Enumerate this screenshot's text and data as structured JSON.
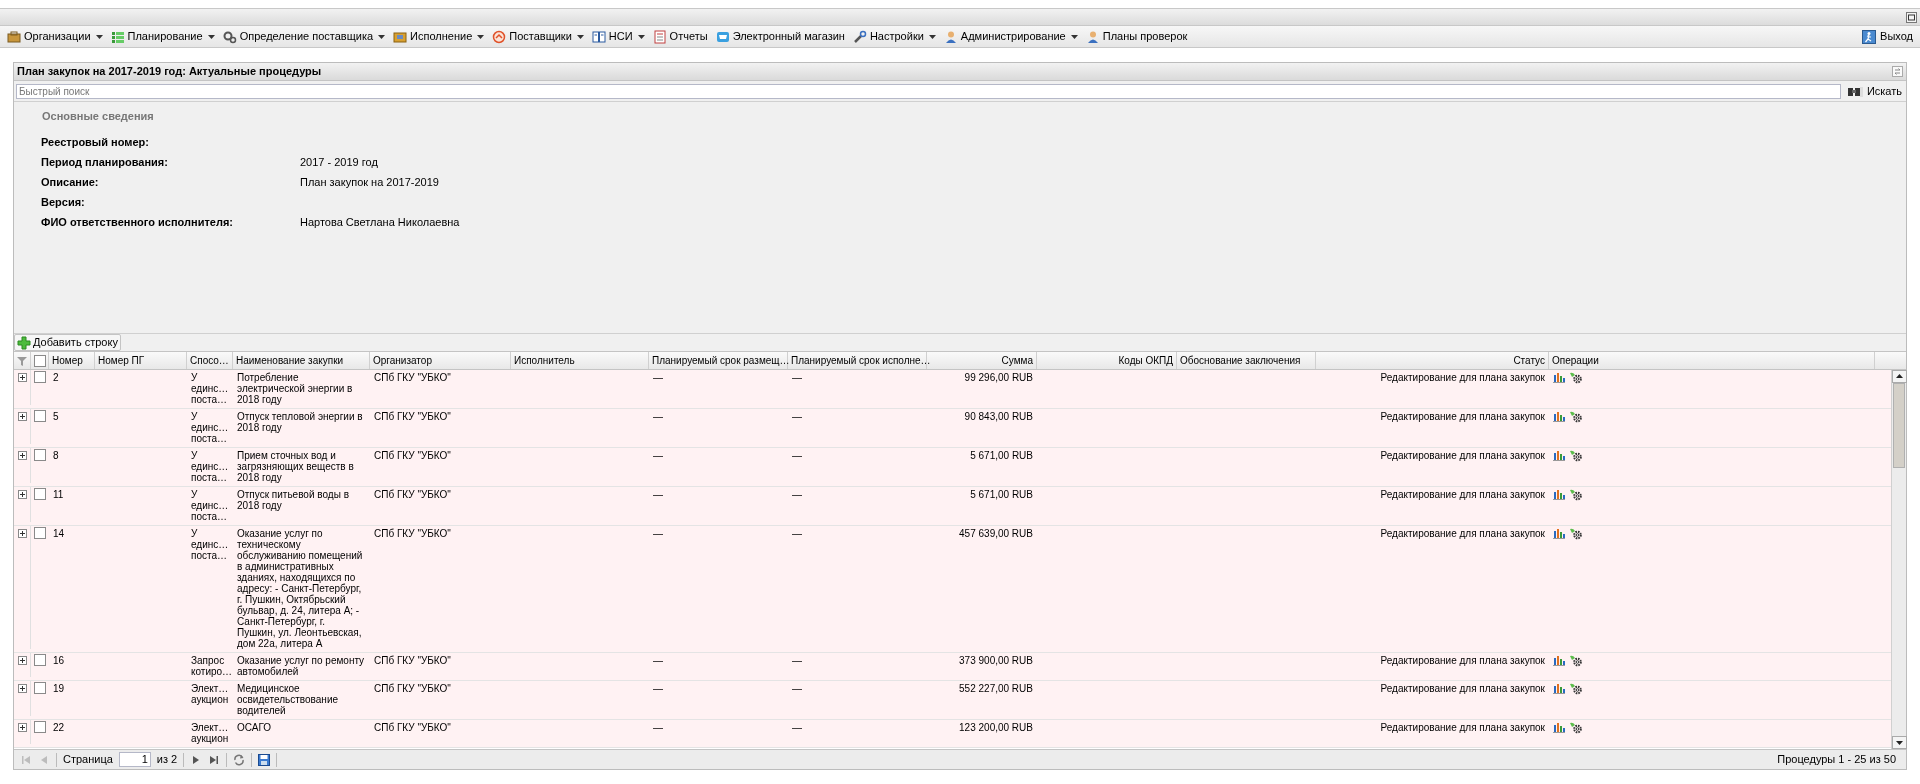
{
  "menu": [
    {
      "label": "Организации",
      "dropdown": true
    },
    {
      "label": "Планирование",
      "dropdown": true
    },
    {
      "label": "Определение поставщика",
      "dropdown": true
    },
    {
      "label": "Исполнение",
      "dropdown": true
    },
    {
      "label": "Поставщики",
      "dropdown": true
    },
    {
      "label": "НСИ",
      "dropdown": true
    },
    {
      "label": "Отчеты",
      "dropdown": false
    },
    {
      "label": "Электронный магазин",
      "dropdown": false
    },
    {
      "label": "Настройки",
      "dropdown": true
    },
    {
      "label": "Администрирование",
      "dropdown": true
    },
    {
      "label": "Планы проверок",
      "dropdown": false
    }
  ],
  "logout": "Выход",
  "panel": {
    "title": "План закупок на 2017-2019 год: Актуальные процедуры",
    "search": {
      "placeholder": "Быстрый поиск",
      "button": "Искать"
    },
    "section_title": "Основные сведения",
    "fields": [
      {
        "label": "Реестровый номер:"
      },
      {
        "label": "Период планирования:",
        "value": "2017 - 2019 год"
      },
      {
        "label": "Описание:",
        "value": "План закупок на 2017-2019"
      },
      {
        "label": "Версия:"
      },
      {
        "label": "ФИО ответственного исполнителя:",
        "value": "Нартова Светлана Николаевна"
      }
    ],
    "add_button": "Добавить строку"
  },
  "table": {
    "header_checked": false,
    "columns": [
      "Номер",
      "Номер ПГ",
      "Спосо…",
      "Наименование закупки",
      "Организатор",
      "Исполнитель",
      "Планируемый срок размещ…",
      "Планируемый срок исполне…",
      "Сумма",
      "Коды ОКПД",
      "Обоснование заключения",
      "Статус",
      "Операции"
    ],
    "rows": [
      {
        "checked": false,
        "expanded": false,
        "number": "2",
        "method": "У\nединс…\nпоста…",
        "name": "Потребление электрической энергии в 2018 году",
        "organizer": "СПб ГКУ \"УБКО\"",
        "placement": "—",
        "execution": "—",
        "sum": "99 296,00 RUB",
        "status": "Редактирование для плана закупок"
      },
      {
        "checked": false,
        "expanded": false,
        "number": "5",
        "method": "У\nединс…\nпоста…",
        "name": "Отпуск тепловой энергии в 2018 году",
        "organizer": "СПб ГКУ \"УБКО\"",
        "placement": "—",
        "execution": "—",
        "sum": "90 843,00 RUB",
        "status": "Редактирование для плана закупок"
      },
      {
        "checked": false,
        "expanded": false,
        "number": "8",
        "method": "У\nединс…\nпоста…",
        "name": "Прием сточных вод и загрязняющих веществ в 2018 году",
        "organizer": "СПб ГКУ \"УБКО\"",
        "placement": "—",
        "execution": "—",
        "sum": "5 671,00 RUB",
        "status": "Редактирование для плана закупок"
      },
      {
        "checked": false,
        "expanded": false,
        "number": "11",
        "method": "У\nединс…\nпоста…",
        "name": "Отпуск питьевой воды в 2018 году",
        "organizer": "СПб ГКУ \"УБКО\"",
        "placement": "—",
        "execution": "—",
        "sum": "5 671,00 RUB",
        "status": "Редактирование для плана закупок"
      },
      {
        "checked": false,
        "expanded": false,
        "number": "14",
        "method": "У\nединс…\nпоста…",
        "name": "Оказание услуг по техническому обслуживанию помещений в административных зданиях, находящихся по адресу: - Санкт-Петербург, г. Пушкин, Октябрьский бульвар, д. 24, литера А; - Санкт-Петербург, г. Пушкин, ул. Леонтьевская, дом 22а, литера А",
        "organizer": "СПб ГКУ \"УБКО\"",
        "placement": "—",
        "execution": "—",
        "sum": "457 639,00 RUB",
        "status": "Редактирование для плана закупок"
      },
      {
        "checked": false,
        "expanded": false,
        "number": "16",
        "method": "Запрос\nкотиро…",
        "name": "Оказание услуг по ремонту автомобилей",
        "organizer": "СПб ГКУ \"УБКО\"",
        "placement": "—",
        "execution": "—",
        "sum": "373 900,00 RUB",
        "status": "Редактирование для плана закупок"
      },
      {
        "checked": false,
        "expanded": false,
        "number": "19",
        "method": "Элект…\nаукцион",
        "name": "Медицинское освидетельствование водителей",
        "organizer": "СПб ГКУ \"УБКО\"",
        "placement": "—",
        "execution": "—",
        "sum": "552 227,00 RUB",
        "status": "Редактирование для плана закупок"
      },
      {
        "checked": false,
        "expanded": false,
        "number": "22",
        "method": "Элект…\nаукцион",
        "name": "ОСАГО",
        "organizer": "СПб ГКУ \"УБКО\"",
        "placement": "—",
        "execution": "—",
        "sum": "123 200,00 RUB",
        "status": "Редактирование для плана закупок"
      }
    ]
  },
  "pager": {
    "page_label": "Страница",
    "page": "1",
    "of": "из 2",
    "summary": "Процедуры 1 - 25 из 50"
  }
}
